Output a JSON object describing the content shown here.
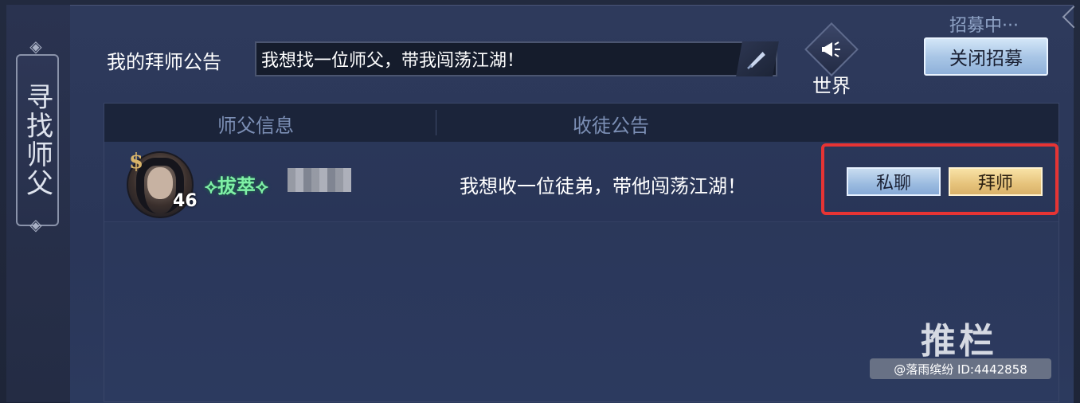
{
  "side": {
    "title": "寻找师父"
  },
  "header": {
    "notice_label": "我的拜师公告",
    "notice_value": "我想找一位师父，带我闯荡江湖！",
    "world_label": "世界",
    "recruit_status": "招募中···",
    "close_recruit_label": "关闭招募"
  },
  "table": {
    "columns": [
      "师父信息",
      "收徒公告"
    ],
    "rows": [
      {
        "level": "46",
        "title": "拔萃",
        "notice": "我想收一位徒弟，带他闯荡江湖！",
        "actions": {
          "chat": "私聊",
          "apprentice": "拜师"
        }
      }
    ]
  },
  "watermark": {
    "brand": "推栏",
    "credit": "@落雨缤纷 ID:4442858"
  },
  "icons": {
    "edit": "brush-icon",
    "world": "megaphone-icon",
    "badge": "rank-badge-icon",
    "ornament": "diamond-ornament-icon"
  },
  "colors": {
    "title_green": "#7ff0a6",
    "highlight_red": "#e63434",
    "apprentice_gold": "#e6c37b",
    "chat_blue": "#9bbbe0"
  }
}
